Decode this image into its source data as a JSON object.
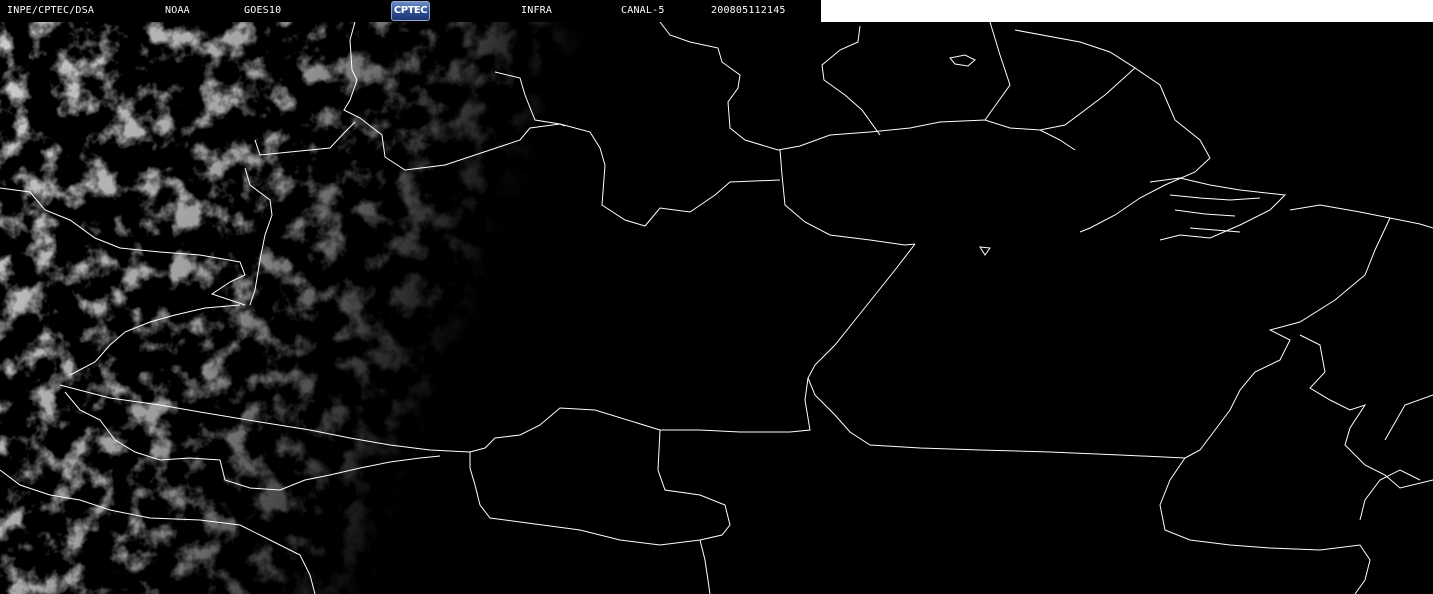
{
  "header": {
    "source": "INPE/CPTEC/DSA",
    "agency": "NOAA",
    "satellite": "GOES10",
    "logo_text": "CPTEC",
    "band": "INFRA",
    "channel": "CANAL-5",
    "timestamp": "200805112145"
  },
  "map": {
    "background_color": "#000000",
    "border_color": "#ffffff",
    "cloud_color": "#9a9a9a",
    "logo_color": "#2e4f93"
  }
}
